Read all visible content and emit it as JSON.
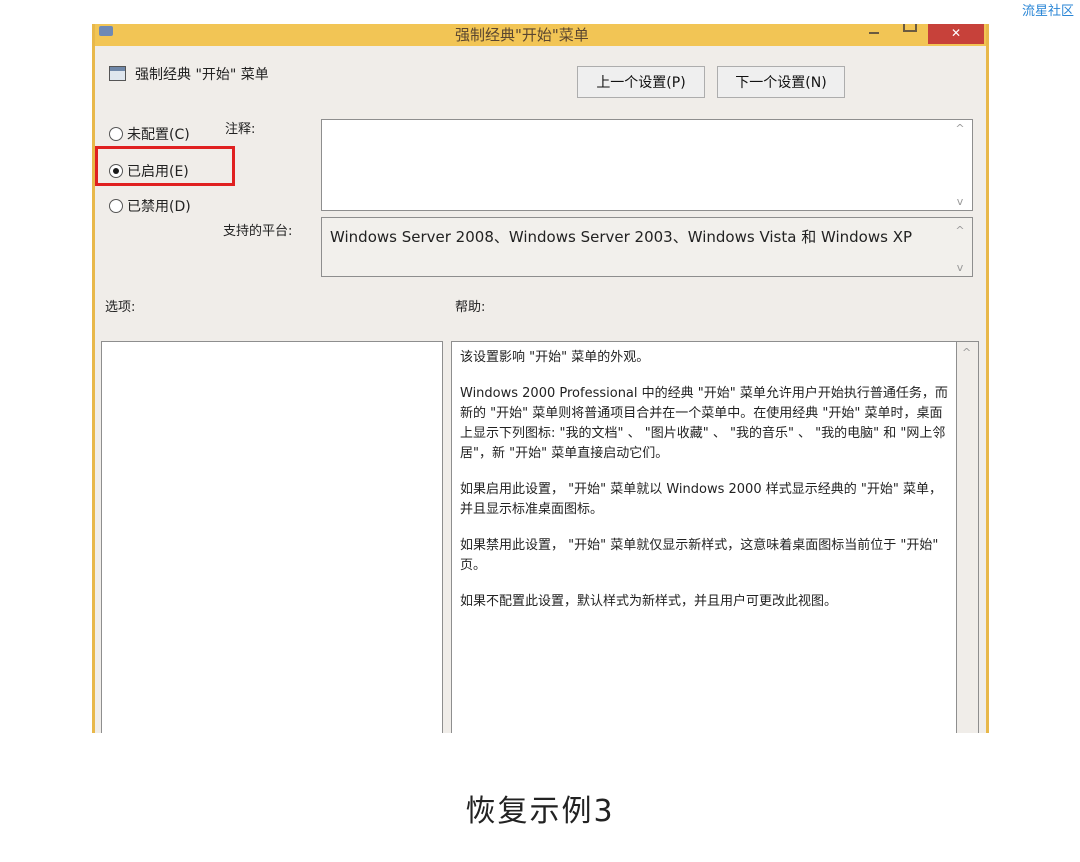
{
  "watermark": "流星社区",
  "window": {
    "title": "强制经典\"开始\"菜单",
    "close_label": "✕"
  },
  "policy": {
    "title": "强制经典 \"开始\" 菜单"
  },
  "buttons": {
    "prev": "上一个设置(P)",
    "next": "下一个设置(N)"
  },
  "radios": {
    "unconfigured": "未配置(C)",
    "enabled": "已启用(E)",
    "disabled": "已禁用(D)",
    "selected": "enabled"
  },
  "labels": {
    "comment": "注释:",
    "platform": "支持的平台:",
    "options": "选项:",
    "help": "帮助:"
  },
  "platform_text": "Windows Server 2008、Windows Server 2003、Windows Vista 和 Windows XP",
  "help": {
    "p1": "该设置影响 \"开始\" 菜单的外观。",
    "p2": "Windows 2000 Professional 中的经典 \"开始\" 菜单允许用户开始执行普通任务，而新的 \"开始\" 菜单则将普通项目合并在一个菜单中。在使用经典 \"开始\" 菜单时，桌面上显示下列图标: \"我的文档\" 、 \"图片收藏\" 、 \"我的音乐\" 、 \"我的电脑\" 和 \"网上邻居\"，新 \"开始\" 菜单直接启动它们。",
    "p3": "如果启用此设置， \"开始\" 菜单就以 Windows 2000 样式显示经典的 \"开始\" 菜单，并且显示标准桌面图标。",
    "p4": "如果禁用此设置， \"开始\" 菜单就仅显示新样式，这意味着桌面图标当前位于 \"开始\" 页。",
    "p5": "如果不配置此设置，默认样式为新样式，并且用户可更改此视图。"
  },
  "caption": "恢复示例3"
}
